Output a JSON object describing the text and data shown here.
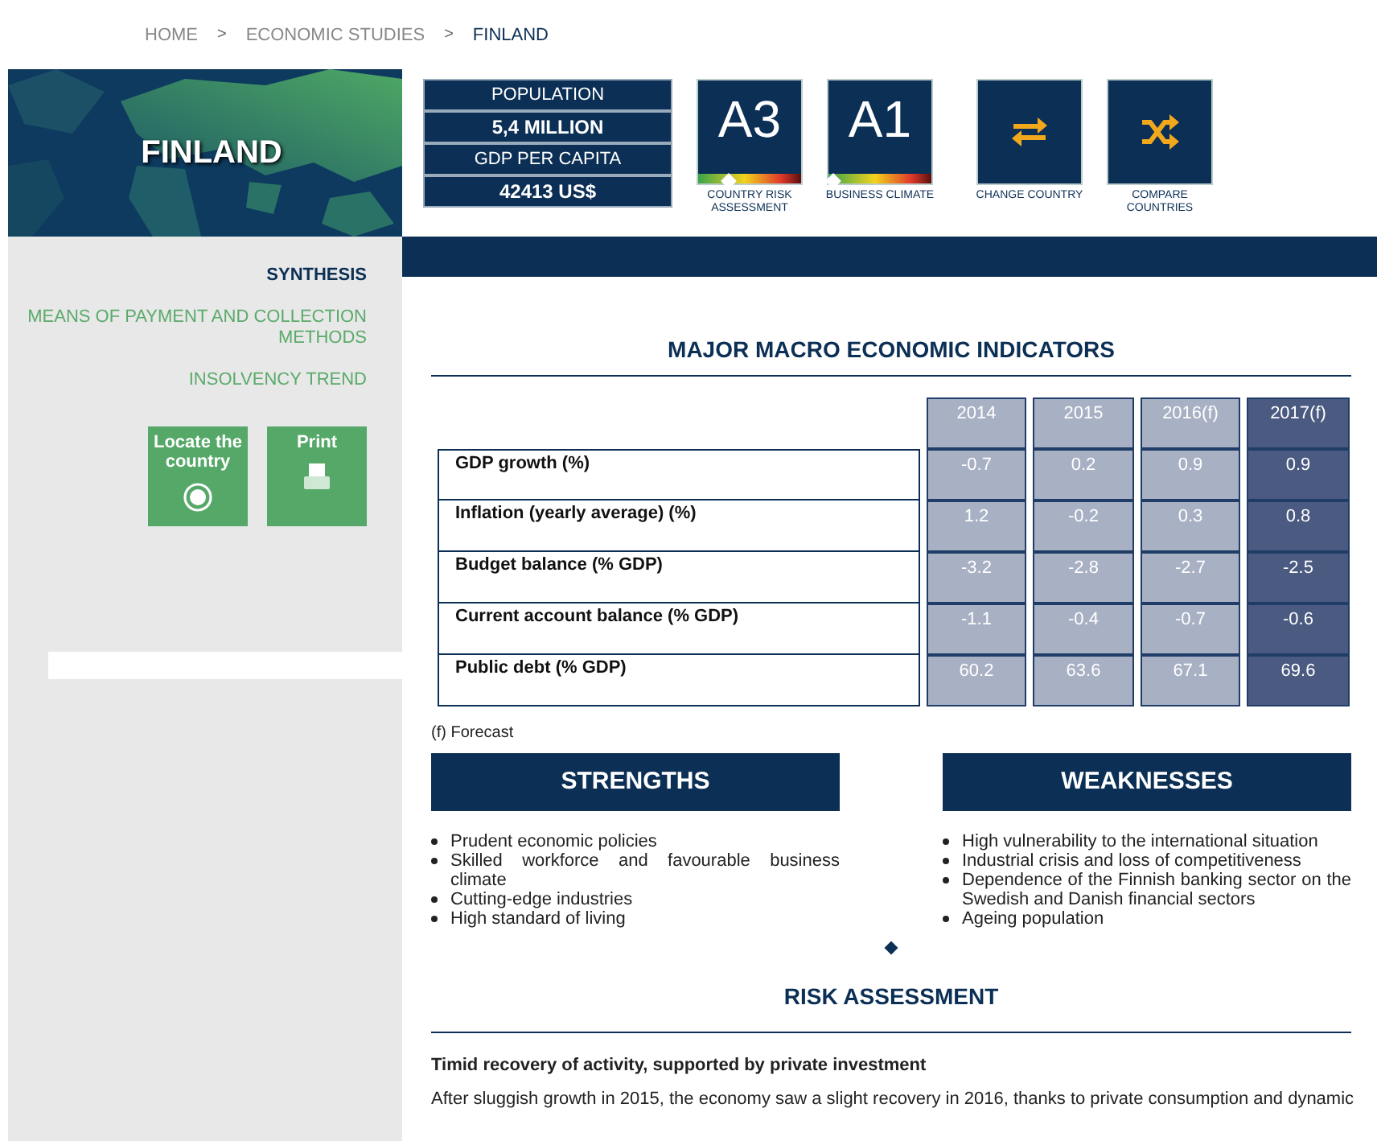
{
  "breadcrumb": [
    {
      "label": "HOME",
      "current": false
    },
    {
      "label": ">",
      "kind": "separator"
    },
    {
      "label": "ECONOMIC STUDIES",
      "current": false
    },
    {
      "label": ">",
      "kind": "separator"
    },
    {
      "label": "FINLAND",
      "current": true
    }
  ],
  "hero": {
    "title": "FINLAND",
    "kind": "picture"
  },
  "stats": [
    {
      "label": "POPULATION",
      "value": "5,4 MILLION"
    },
    {
      "label": "GDP PER CAPITA",
      "value": "42413 US$"
    }
  ],
  "ratings": [
    {
      "grade": "A3",
      "label": "COUNTRY RISK ASSESSMENT",
      "level": 0.3
    },
    {
      "grade": "A1",
      "label": "BUSINESS CLIMATE",
      "level": 0.05
    }
  ],
  "actions": [
    {
      "label": "CHANGE COUNTRY",
      "kind": "change"
    },
    {
      "label": "COMPARE COUNTRIES",
      "kind": "compare"
    }
  ],
  "sidebar": {
    "items": [
      {
        "label": "SYNTHESIS",
        "selected": true
      },
      {
        "label": "MEANS OF PAYMENT AND COLLECTION METHODS",
        "selected": false
      },
      {
        "label": "INSOLVENCY TREND",
        "selected": false
      }
    ],
    "buttons": [
      {
        "label": "Locate the country",
        "kind": "locate"
      },
      {
        "label": "Print",
        "kind": "print"
      }
    ]
  },
  "indicators": {
    "title": "MAJOR MACRO ECONOMIC INDICATORS",
    "columns": [
      {
        "label": "2014",
        "highlighted": false
      },
      {
        "label": "2015",
        "highlighted": false
      },
      {
        "label": "2016(f)",
        "highlighted": false
      },
      {
        "label": "2017(f)",
        "highlighted": true
      }
    ],
    "rows": [
      {
        "label": "GDP growth (%)",
        "values": [
          "-0.7",
          "0.2",
          "0.9",
          "0.9"
        ]
      },
      {
        "label": "Inflation (yearly average) (%)",
        "values": [
          "1.2",
          "-0.2",
          "0.3",
          "0.8"
        ]
      },
      {
        "label": "Budget balance (% GDP)",
        "values": [
          "-3.2",
          "-2.8",
          "-2.7",
          "-2.5"
        ]
      },
      {
        "label": "Current account balance (% GDP)",
        "values": [
          "-1.1",
          "-0.4",
          "-0.7",
          "-0.6"
        ]
      },
      {
        "label": "Public debt (% GDP)",
        "values": [
          "60.2",
          "63.6",
          "67.1",
          "69.6"
        ]
      }
    ],
    "note": "(f) Forecast"
  },
  "swot": [
    {
      "title": "STRENGTHS",
      "items": [
        "Prudent economic policies",
        "Skilled workforce and favourable business climate",
        "Cutting-edge industries",
        "High standard of living"
      ]
    },
    {
      "title": "WEAKNESSES",
      "items": [
        "High vulnerability to the international situation",
        "Industrial crisis and loss of competitiveness",
        "Dependence of the Finnish banking sector on the Swedish and Danish financial sectors",
        "Ageing population"
      ]
    }
  ],
  "risk": {
    "title": "RISK ASSESSMENT",
    "subtitle": "Timid recovery of activity, supported by private investment",
    "text": "After sluggish growth in 2015, the economy saw a slight recovery in 2016, thanks to private consumption and dynamic"
  }
}
